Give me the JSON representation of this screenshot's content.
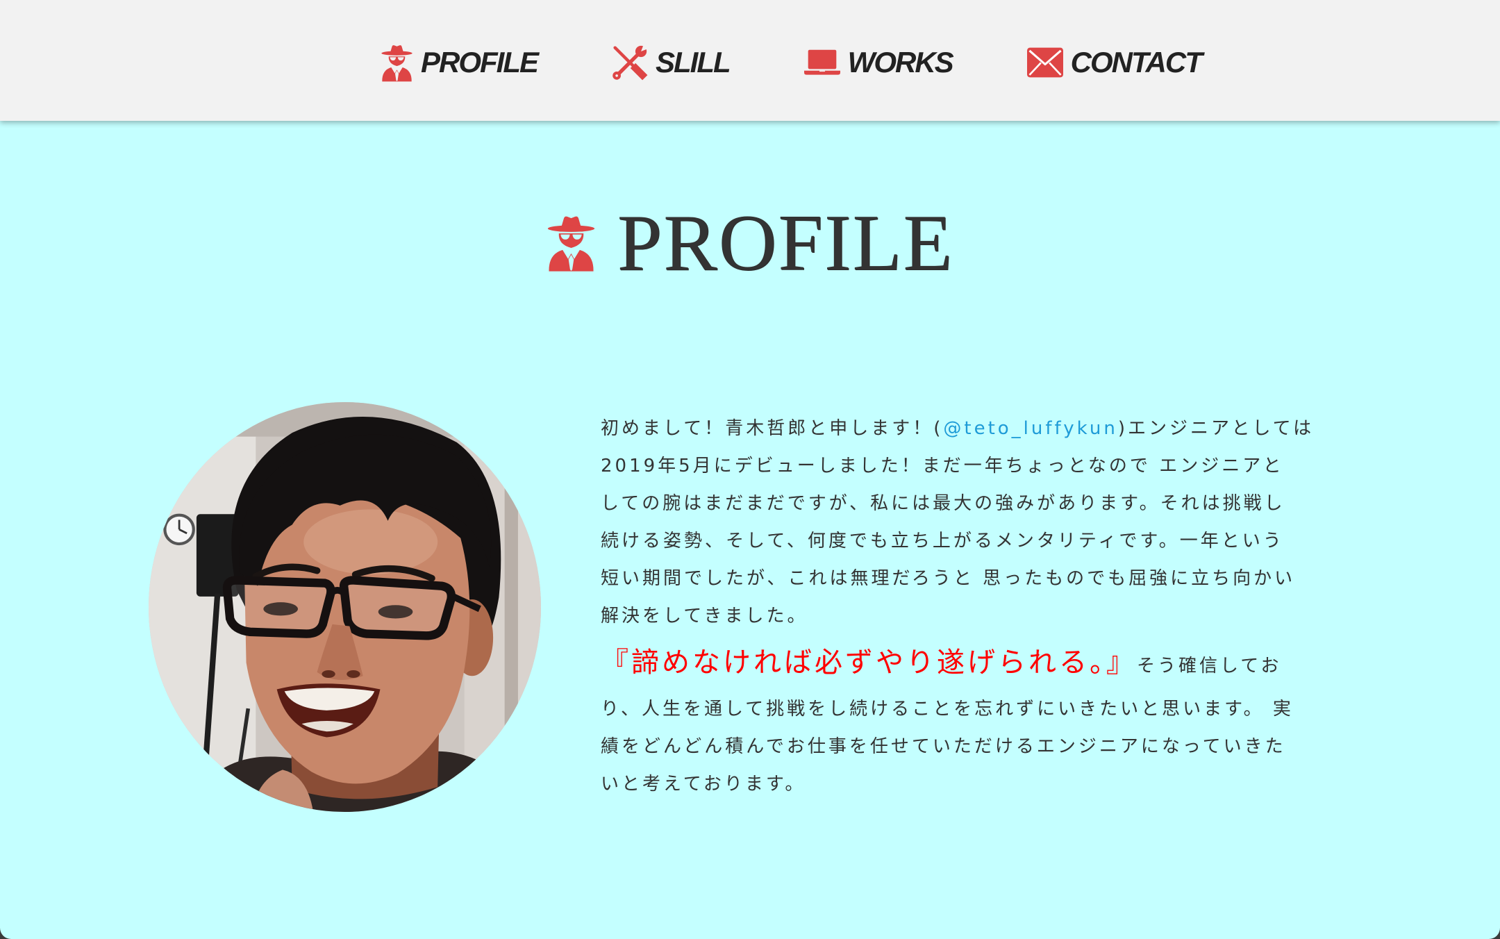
{
  "nav": {
    "items": [
      {
        "label": "PROFILE",
        "icon": "user-secret-icon"
      },
      {
        "label": "SLILL",
        "icon": "tools-icon"
      },
      {
        "label": "WORKS",
        "icon": "laptop-icon"
      },
      {
        "label": "CONTACT",
        "icon": "envelope-icon"
      }
    ]
  },
  "profile": {
    "heading": "PROFILE",
    "heading_icon": "user-secret-icon",
    "intro": {
      "line1_before": "初めまして！青木哲郎と申します！(",
      "twitter_handle": "@teto_luffykun",
      "line1_after": ")エンジニアとしては",
      "lines": [
        "2019年5月にデビューしました！まだ一年ちょっとなので エンジニアと",
        "しての腕はまだまだですが、私には最大の強みがあります。それは挑戦し",
        "続ける姿勢、そして、何度でも立ち上がるメンタリティです。一年という",
        "短い期間でしたが、これは無理だろうと 思ったものでも屈強に立ち向かい",
        "解決をしてきました。"
      ]
    },
    "motto": "『諦めなければ必ずやり遂げられる。』",
    "closing": {
      "first_line": "そう確信してお",
      "lines": [
        "り、人生を通して挑戦をし続けることを忘れずにいきたいと思います。 実",
        "績をどんどん積んでお仕事を任せていただけるエンジニアになっていきた",
        "いと考えております。"
      ]
    }
  },
  "colors": {
    "accent": "#de4545",
    "page_background": "#c4ffff",
    "header_background": "#f2f2f2",
    "link": "#1e9bd7",
    "motto": "#ff0000"
  }
}
